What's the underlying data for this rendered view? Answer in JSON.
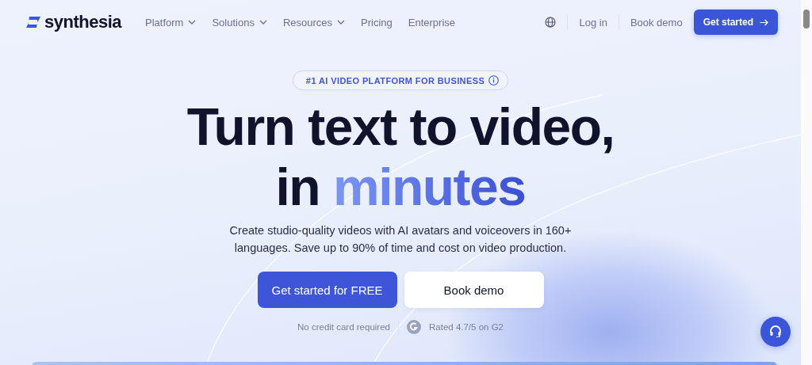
{
  "header": {
    "logo": "synthesia",
    "nav": [
      {
        "label": "Platform",
        "dropdown": true
      },
      {
        "label": "Solutions",
        "dropdown": true
      },
      {
        "label": "Resources",
        "dropdown": true
      },
      {
        "label": "Pricing",
        "dropdown": false
      },
      {
        "label": "Enterprise",
        "dropdown": false
      }
    ],
    "login": "Log in",
    "book_demo": "Book demo",
    "cta": "Get started"
  },
  "hero": {
    "badge": "#1 AI VIDEO PLATFORM FOR BUSINESS",
    "headline": [
      [
        {
          "text": "Turn text to video,",
          "accent": false
        }
      ],
      [
        {
          "text": "in",
          "accent": false
        },
        {
          "text": "minutes",
          "accent": true
        }
      ]
    ],
    "subtitle": "Create studio-quality videos with AI avatars and voiceovers in 160+ languages. Save up to 90% of time and cost on video production.",
    "buttons": [
      {
        "label": "Get started for FREE",
        "kind": "primary"
      },
      {
        "label": "Book demo",
        "kind": "secondary"
      }
    ],
    "note": "No credit card required",
    "rating": "Rated 4.7/5 on G2"
  }
}
